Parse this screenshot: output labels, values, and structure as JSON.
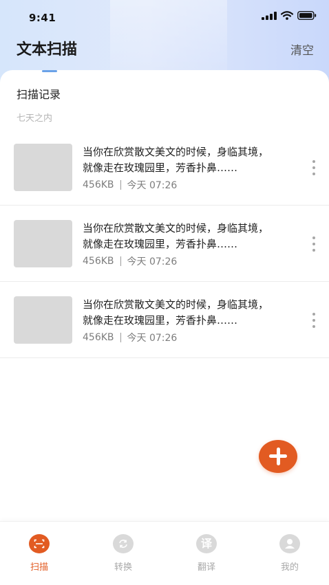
{
  "status_bar": {
    "time": "9:41"
  },
  "header": {
    "title": "文本扫描",
    "clear_label": "清空"
  },
  "section": {
    "title": "扫描记录",
    "subtitle": "七天之内"
  },
  "records": [
    {
      "line1": "当你在欣赏散文美文的时候，身临其境，",
      "line2": "就像走在玫瑰园里，芳香扑鼻……",
      "size": "456KB",
      "time": "今天 07:26"
    },
    {
      "line1": "当你在欣赏散文美文的时候，身临其境，",
      "line2": "就像走在玫瑰园里，芳香扑鼻……",
      "size": "456KB",
      "time": "今天 07:26"
    },
    {
      "line1": "当你在欣赏散文美文的时候，身临其境，",
      "line2": "就像走在玫瑰园里，芳香扑鼻……",
      "size": "456KB",
      "time": "今天 07:26"
    }
  ],
  "tabs": [
    {
      "label": "扫描",
      "icon": "scan-icon",
      "active": true
    },
    {
      "label": "转换",
      "icon": "convert-icon",
      "active": false
    },
    {
      "label": "翻译",
      "icon": "translate-icon",
      "glyph": "译",
      "active": false
    },
    {
      "label": "我的",
      "icon": "profile-icon",
      "active": false
    }
  ],
  "colors": {
    "accent": "#e25b22",
    "thumbnail": "#d9d9d9",
    "header_gradient": "#d6e6fb"
  }
}
